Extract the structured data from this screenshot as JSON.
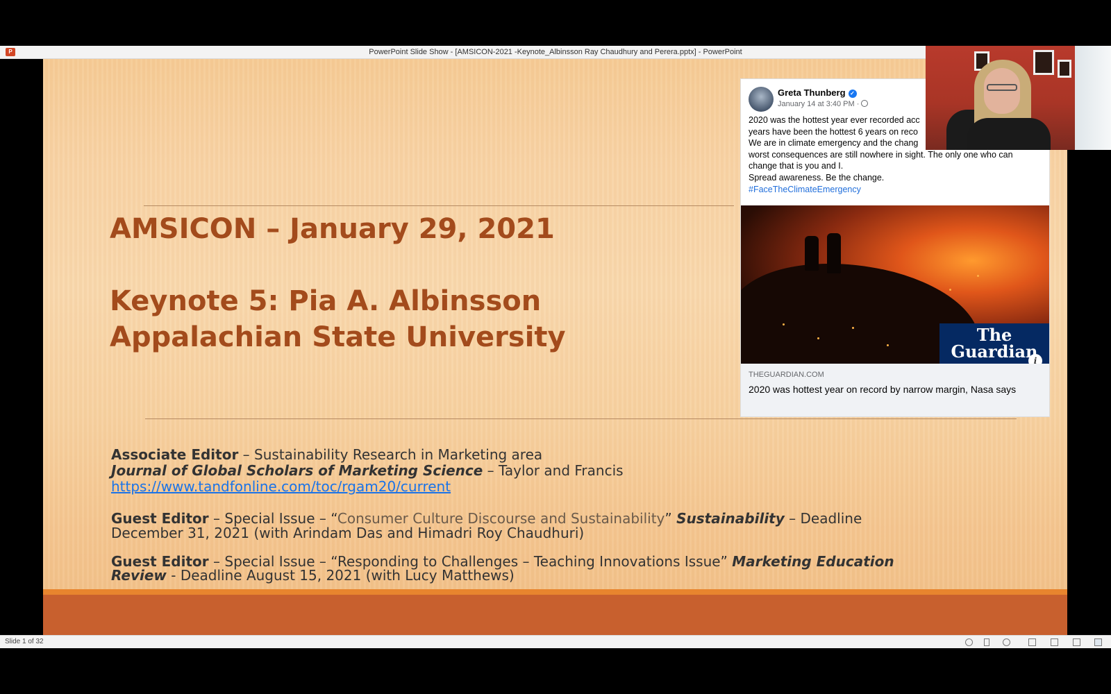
{
  "window": {
    "title": "PowerPoint Slide Show - [AMSICON-2021 -Keynote_Albinsson Ray Chaudhury and Perera.pptx] - PowerPoint"
  },
  "slide": {
    "title_line1": "AMSICON – January 29, 2021",
    "title_line2": "Keynote 5: Pia A. Albinsson",
    "title_line3": "Appalachian State University",
    "assoc_editor_label": "Associate Editor",
    "assoc_editor_text": " – Sustainability Research in Marketing area",
    "journal_name": "Journal of Global Scholars of Marketing Science",
    "journal_publisher": " – Taylor and Francis",
    "journal_link": "https://www.tandfonline.com/toc/rgam20/current",
    "guest1_label": "Guest Editor",
    "guest1_pre": " – Special Issue – “",
    "guest1_title": "Consumer Culture Discourse and Sustainability",
    "guest1_close": "” ",
    "guest1_journal": "Sustainability",
    "guest1_deadline": " – Deadline",
    "guest1_line2": "December 31, 2021 (with Arindam Das and Himadri Roy Chaudhuri)",
    "guest2_label": "Guest Editor",
    "guest2_text": " – Special Issue – “Responding to Challenges – Teaching Innovations Issue” ",
    "guest2_journal": "Marketing Education",
    "guest2_journal2": "Review",
    "guest2_line2": " - Deadline August 15, 2021 (with Lucy Matthews)"
  },
  "facebook_post": {
    "author": "Greta Thunberg",
    "timestamp": "January 14 at 3:40 PM ·",
    "lines": [
      "2020 was the hottest year ever recorded acc",
      "years have been the hottest 6 years on reco",
      "We are in climate emergency and the chang",
      "worst consequences are still nowhere in sight. The only one who can",
      "change that is you and I.",
      "Spread awareness. Be the change."
    ],
    "hashtag": "#FaceTheClimateEmergency",
    "image_logo_line1": "The",
    "image_logo_line2": "Guardian",
    "link_domain": "THEGUARDIAN.COM",
    "link_headline": "2020 was hottest year on record by narrow margin, Nasa says"
  },
  "status_bar": {
    "slide_counter": "Slide 1 of 32"
  },
  "colors": {
    "title": "#a34b1c",
    "accent_band": "#c8602e",
    "accent_stripe": "#e8852e",
    "link": "#1a73e8"
  }
}
